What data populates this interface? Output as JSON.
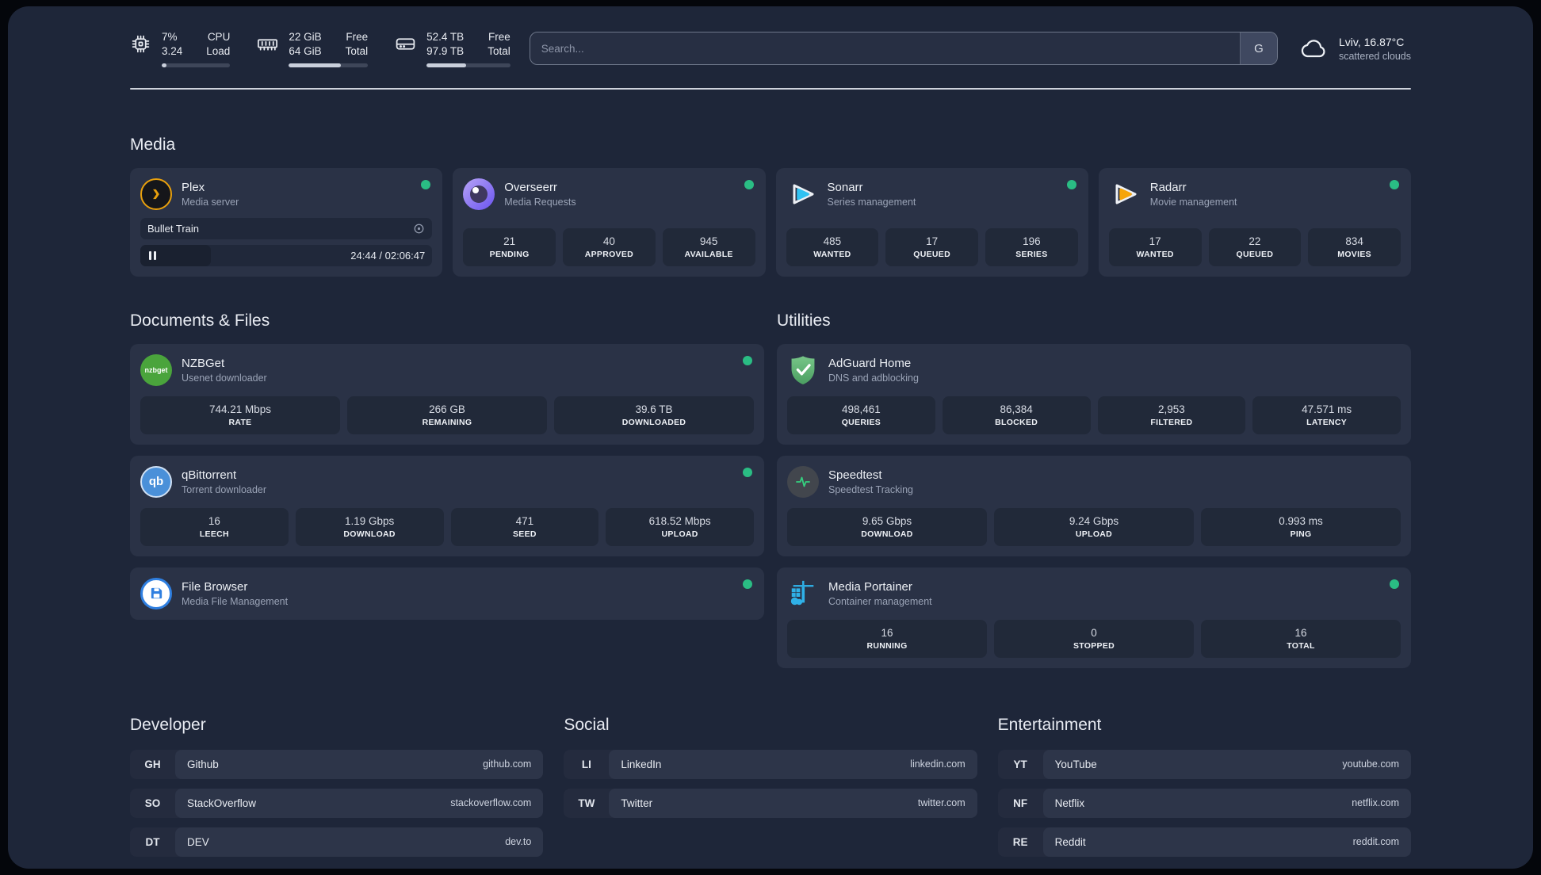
{
  "header": {
    "system_stats": [
      {
        "name": "cpu",
        "value_top": "7%",
        "value_bottom": "3.24",
        "label_top": "CPU",
        "label_bottom": "Load",
        "progress_pct": 7
      },
      {
        "name": "memory",
        "value_top": "22 GiB",
        "value_bottom": "64 GiB",
        "label_top": "Free",
        "label_bottom": "Total",
        "progress_pct": 66
      },
      {
        "name": "disk",
        "value_top": "52.4 TB",
        "value_bottom": "97.9 TB",
        "label_top": "Free",
        "label_bottom": "Total",
        "progress_pct": 47
      }
    ],
    "search": {
      "placeholder": "Search...",
      "provider": "G"
    },
    "weather": {
      "summary": "Lviv, 16.87°C",
      "condition": "scattered clouds"
    }
  },
  "media": {
    "title": "Media",
    "plex": {
      "name": "Plex",
      "description": "Media server",
      "status": "online",
      "player": {
        "title": "Bullet Train",
        "time": "24:44 / 02:06:47"
      }
    },
    "overseerr": {
      "name": "Overseerr",
      "description": "Media Requests",
      "status": "online",
      "stats": [
        {
          "value": "21",
          "label": "PENDING"
        },
        {
          "value": "40",
          "label": "APPROVED"
        },
        {
          "value": "945",
          "label": "AVAILABLE"
        }
      ]
    },
    "sonarr": {
      "name": "Sonarr",
      "description": "Series management",
      "status": "online",
      "stats": [
        {
          "value": "485",
          "label": "WANTED"
        },
        {
          "value": "17",
          "label": "QUEUED"
        },
        {
          "value": "196",
          "label": "SERIES"
        }
      ]
    },
    "radarr": {
      "name": "Radarr",
      "description": "Movie management",
      "status": "online",
      "stats": [
        {
          "value": "17",
          "label": "WANTED"
        },
        {
          "value": "22",
          "label": "QUEUED"
        },
        {
          "value": "834",
          "label": "MOVIES"
        }
      ]
    }
  },
  "documents": {
    "title": "Documents & Files",
    "nzbget": {
      "name": "NZBGet",
      "description": "Usenet downloader",
      "status": "online",
      "logo_text": "nzbget",
      "stats": [
        {
          "value": "744.21 Mbps",
          "label": "RATE"
        },
        {
          "value": "266 GB",
          "label": "REMAINING"
        },
        {
          "value": "39.6 TB",
          "label": "DOWNLOADED"
        }
      ]
    },
    "qbittorrent": {
      "name": "qBittorrent",
      "description": "Torrent downloader",
      "status": "online",
      "logo_text": "qb",
      "stats": [
        {
          "value": "16",
          "label": "LEECH"
        },
        {
          "value": "1.19 Gbps",
          "label": "DOWNLOAD"
        },
        {
          "value": "471",
          "label": "SEED"
        },
        {
          "value": "618.52 Mbps",
          "label": "UPLOAD"
        }
      ]
    },
    "filebrowser": {
      "name": "File Browser",
      "description": "Media File Management",
      "status": "online"
    }
  },
  "utilities": {
    "title": "Utilities",
    "adguard": {
      "name": "AdGuard Home",
      "description": "DNS and adblocking",
      "stats": [
        {
          "value": "498,461",
          "label": "QUERIES"
        },
        {
          "value": "86,384",
          "label": "BLOCKED"
        },
        {
          "value": "2,953",
          "label": "FILTERED"
        },
        {
          "value": "47.571 ms",
          "label": "LATENCY"
        }
      ]
    },
    "speedtest": {
      "name": "Speedtest",
      "description": "Speedtest Tracking",
      "stats": [
        {
          "value": "9.65 Gbps",
          "label": "DOWNLOAD"
        },
        {
          "value": "9.24 Gbps",
          "label": "UPLOAD"
        },
        {
          "value": "0.993 ms",
          "label": "PING"
        }
      ]
    },
    "portainer": {
      "name": "Media Portainer",
      "description": "Container management",
      "status": "online",
      "stats": [
        {
          "value": "16",
          "label": "RUNNING"
        },
        {
          "value": "0",
          "label": "STOPPED"
        },
        {
          "value": "16",
          "label": "TOTAL"
        }
      ]
    }
  },
  "bookmarks": {
    "groups": [
      {
        "title": "Developer",
        "links": [
          {
            "abbr": "GH",
            "name": "Github",
            "domain": "github.com"
          },
          {
            "abbr": "SO",
            "name": "StackOverflow",
            "domain": "stackoverflow.com"
          },
          {
            "abbr": "DT",
            "name": "DEV",
            "domain": "dev.to"
          }
        ]
      },
      {
        "title": "Social",
        "links": [
          {
            "abbr": "LI",
            "name": "LinkedIn",
            "domain": "linkedin.com"
          },
          {
            "abbr": "TW",
            "name": "Twitter",
            "domain": "twitter.com"
          }
        ]
      },
      {
        "title": "Entertainment",
        "links": [
          {
            "abbr": "YT",
            "name": "YouTube",
            "domain": "youtube.com"
          },
          {
            "abbr": "NF",
            "name": "Netflix",
            "domain": "netflix.com"
          },
          {
            "abbr": "RE",
            "name": "Reddit",
            "domain": "reddit.com"
          }
        ]
      }
    ]
  },
  "colors": {
    "status_online": "#2abd84",
    "plex": "#e8a00d",
    "sonarr": "#30c2f2",
    "radarr": "#f6a50b",
    "adguard": "#67bc7b",
    "speedtest_pulse": "#35d07f",
    "portainer": "#2fb1e8",
    "qbittorrent": "#4a90d9",
    "nzbget": "#4aa43c",
    "filebrowser": "#2f7fe0",
    "overseerr": "#7a62f0"
  }
}
